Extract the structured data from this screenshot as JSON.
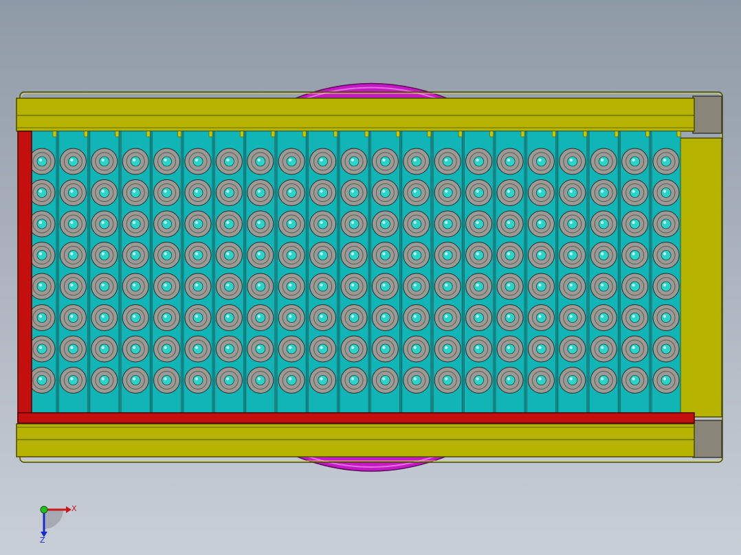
{
  "colors": {
    "background_top": "#8f9aa7",
    "background_bottom": "#c9cfd8",
    "frame_yellow": "#b5b300",
    "frame_outline": "#4a4a00",
    "bracket_gray": "#8a8579",
    "cell_teal": "#11b5b5",
    "cell_outline": "#0b5a5a",
    "cap_gray": "#9c9a94",
    "cap_center": "#2ad4c8",
    "rail_red": "#c40f0f",
    "arc_magenta": "#c41ac4",
    "separator_yellow": "#c8c800"
  },
  "model": {
    "cell_columns": 21,
    "cell_rows": 8,
    "icons": [
      "battery-cell-icon",
      "red-rail",
      "magenta-arc",
      "yellow-frame",
      "gray-corner-bracket"
    ]
  },
  "triad": {
    "x_label": "X",
    "z_label": "Z",
    "icons": [
      "x-axis-arrow-icon",
      "z-axis-arrow-icon",
      "origin-sphere-icon"
    ]
  }
}
